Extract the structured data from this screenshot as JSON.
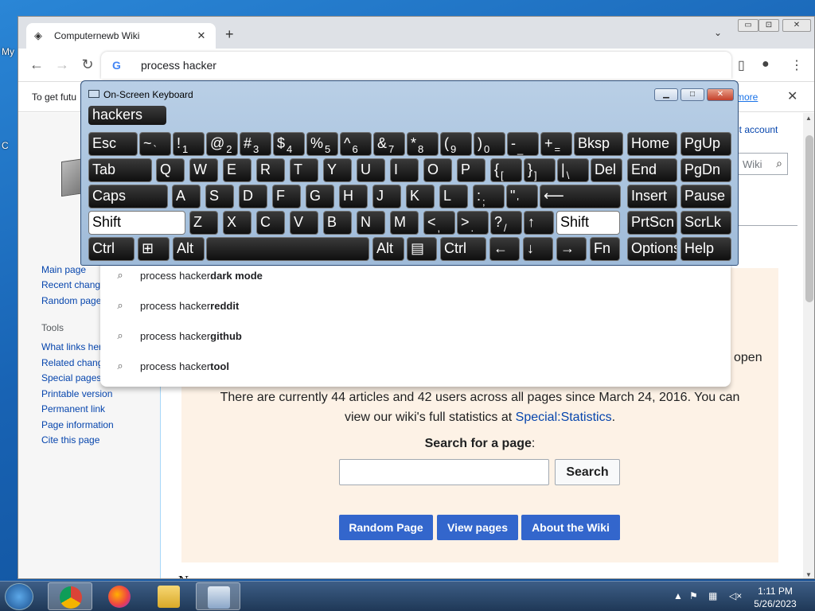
{
  "desktop": {
    "icon_labels": [
      "My",
      "C"
    ]
  },
  "browser": {
    "tab": {
      "title": "Computernewb Wiki",
      "close": "✕"
    },
    "new_tab": "+",
    "tab_menu": "⌄",
    "window_controls": {
      "minimize": "▭",
      "maximize": "⊡",
      "close": "✕"
    },
    "omnibox": {
      "g": "G",
      "value": "process hacker"
    },
    "infobar": {
      "message": "To get futu",
      "link": "rn more",
      "close": "✕"
    }
  },
  "wiki": {
    "sidebar": {
      "nav": [
        "Main page",
        "Recent chang",
        "Random page"
      ],
      "tools_heading": "Tools",
      "tools": [
        "What links her",
        "Related chang",
        "Special pages",
        "Printable version",
        "Permanent link",
        "Page information",
        "Cite this page"
      ]
    },
    "account_link": "est account",
    "search_placeholder": "Wiki",
    "open_text": "open",
    "stats_line1": "There are currently 44 articles and 42 users across all pages since March 24, 2016. You can",
    "stats_line2_prefix": "view our wiki's full statistics at ",
    "stats_link": "Special:Statistics",
    "stats_line2_suffix": ".",
    "search_label": "Search for a page",
    "search_label_colon": ":",
    "search_button": "Search",
    "buttons": [
      "Random Page",
      "View pages",
      "About the Wiki"
    ],
    "news_heading": "News"
  },
  "suggestions": [
    {
      "prefix": "process hacker ",
      "bold": "dark mode"
    },
    {
      "prefix": "process hacker ",
      "bold": "reddit"
    },
    {
      "prefix": "process hacker ",
      "bold": "github"
    },
    {
      "prefix": "process hacker ",
      "bold": "tool"
    }
  ],
  "osk": {
    "title": "On-Screen Keyboard",
    "prediction": "hackers",
    "controls": {
      "minimize": "▁",
      "maximize": "□",
      "close": "✕"
    }
  },
  "taskbar": {
    "time": "1:11 PM",
    "date": "5/26/2023"
  },
  "colors": {
    "wiki_button": "#3366cc",
    "osk_frame": "#b9cfe6",
    "taskbar": "#2b4a70"
  }
}
